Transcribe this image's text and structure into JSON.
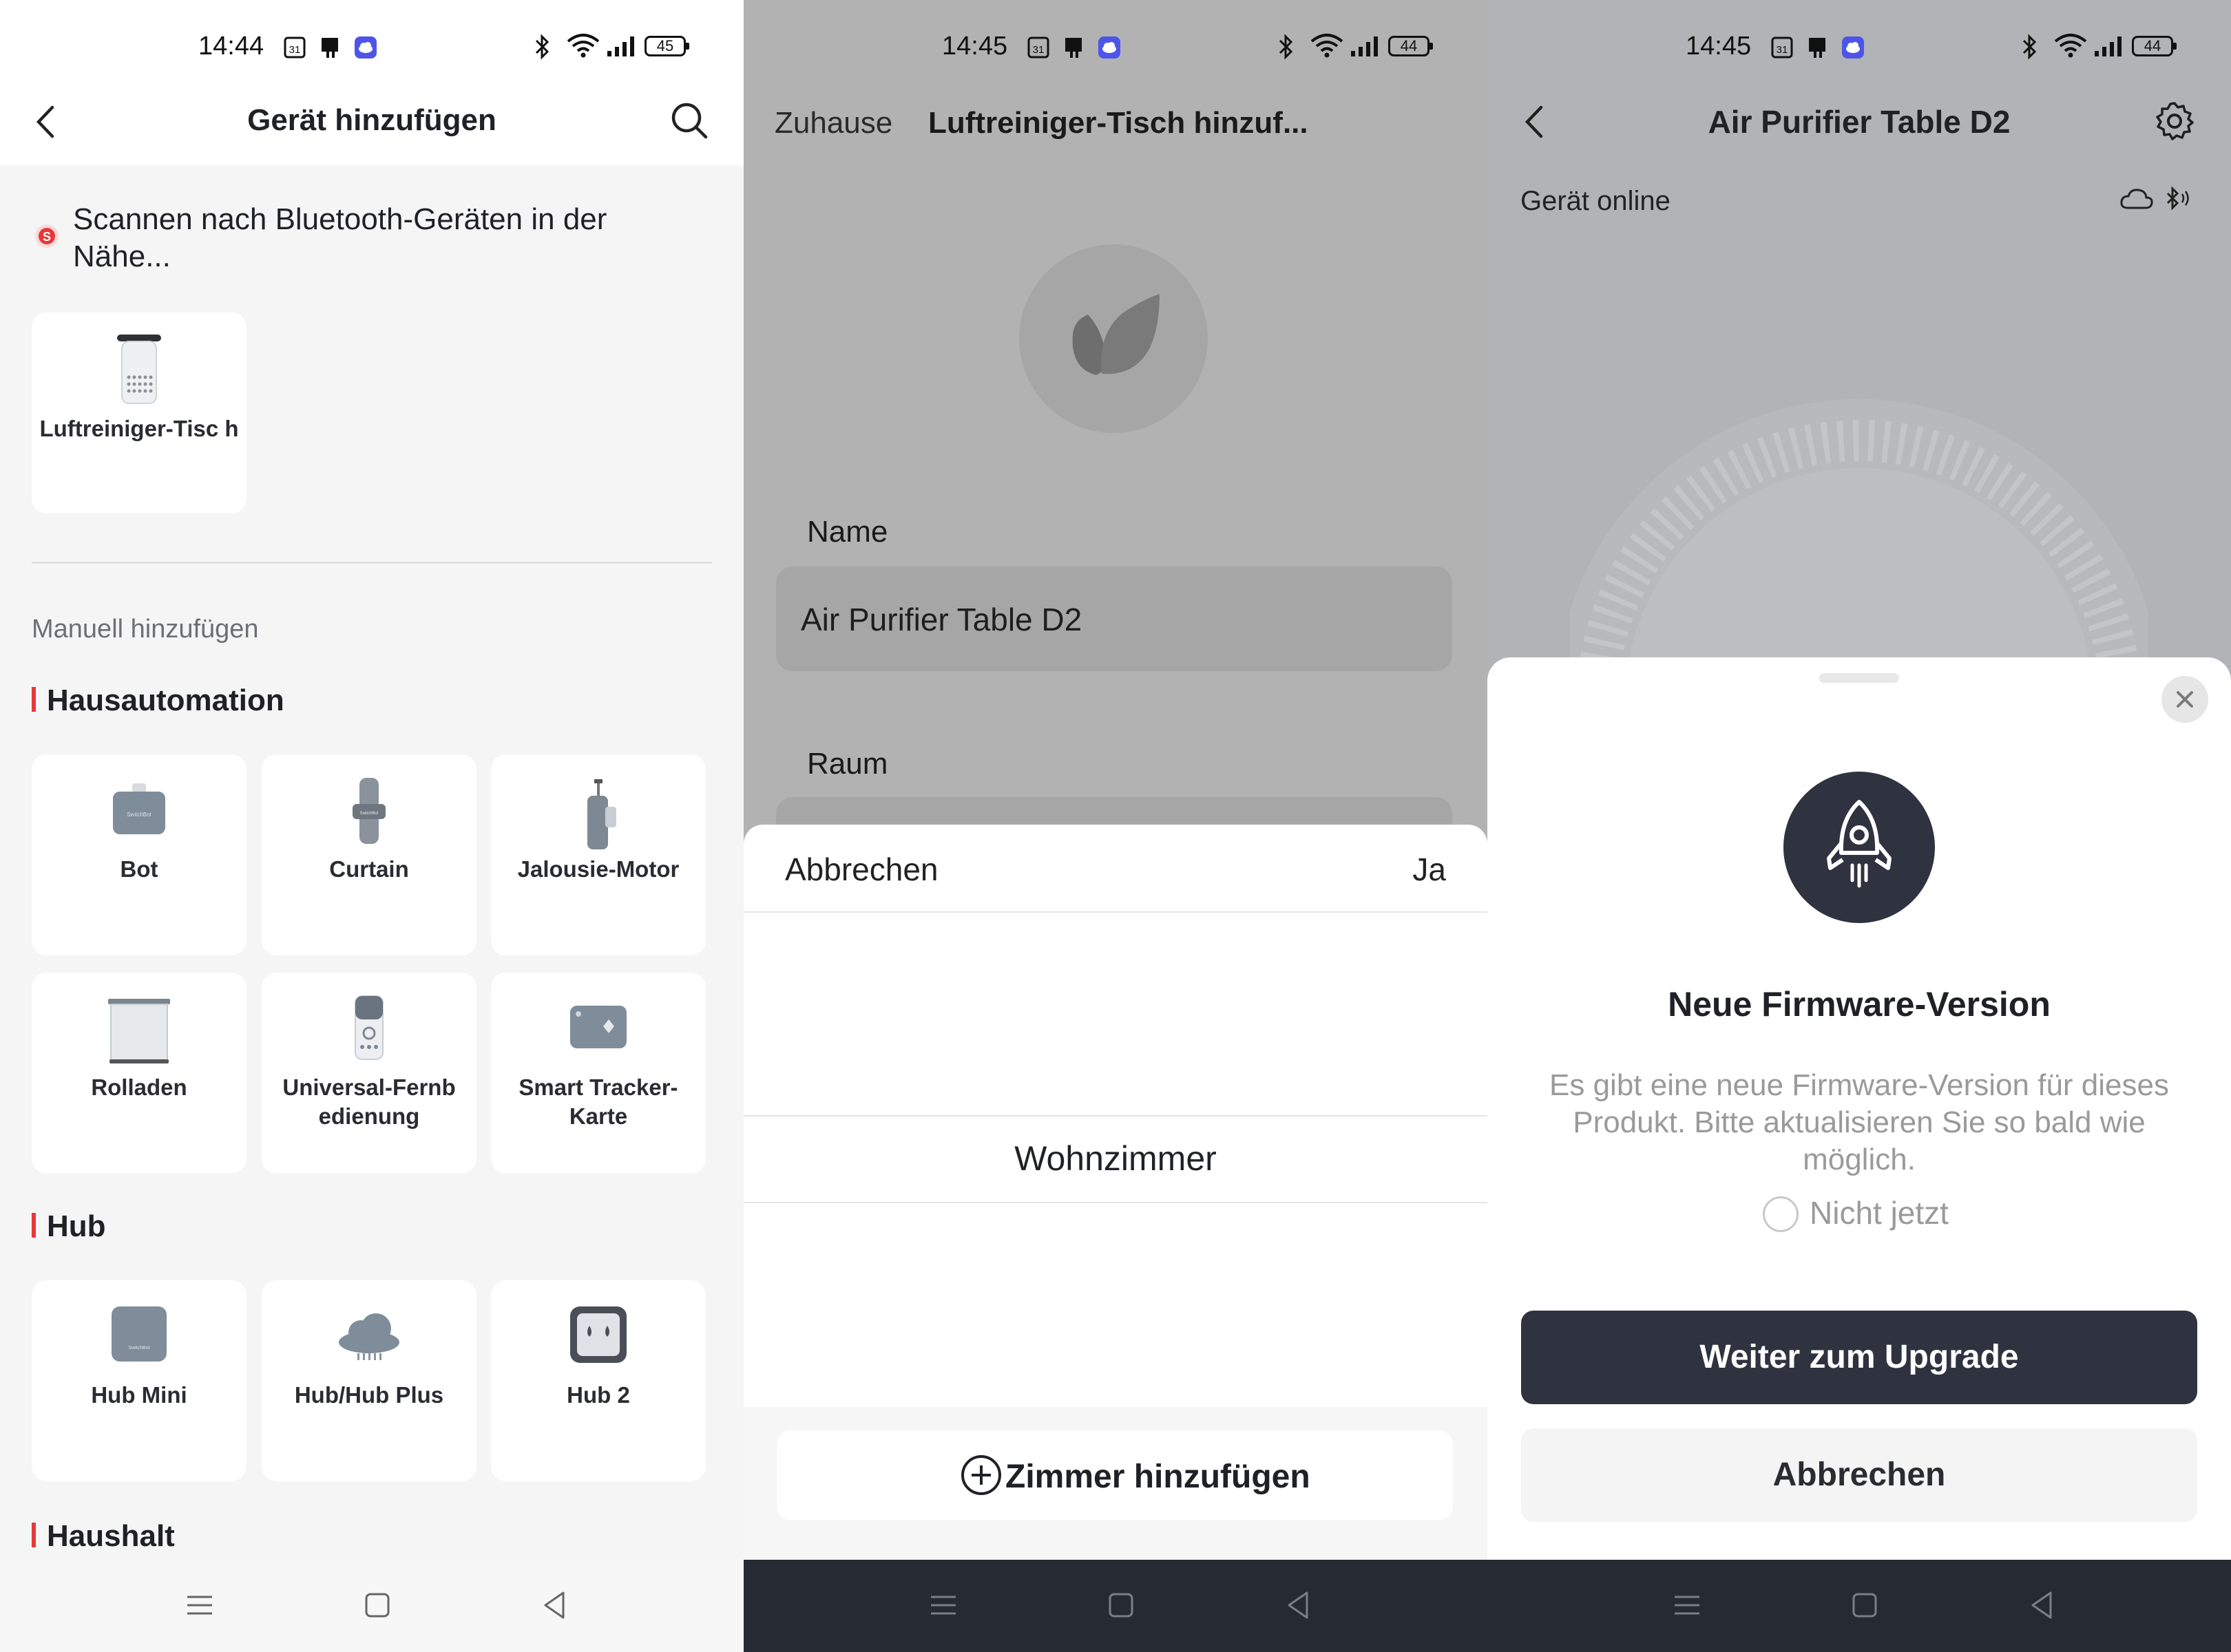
{
  "screen1": {
    "status": {
      "time": "14:44",
      "calendar_badge": "31",
      "battery": "45"
    },
    "title": "Gerät hinzufügen",
    "scanning_text": "Scannen nach Bluetooth-Geräten in der Nähe...",
    "found_device": {
      "label": "Luftreiniger-Tisc h"
    },
    "manual_label": "Manuell hinzufügen",
    "sections": [
      {
        "title": "Hausautomation",
        "items": [
          {
            "label": "Bot",
            "icon": "bot-device-icon"
          },
          {
            "label": "Curtain",
            "icon": "curtain-device-icon"
          },
          {
            "label": "Jalousie-Motor",
            "icon": "blind-motor-icon"
          },
          {
            "label": "Rolladen",
            "icon": "roller-shade-icon"
          },
          {
            "label": "Universal-Fernb edienung",
            "icon": "remote-control-icon"
          },
          {
            "label": "Smart Tracker-Karte",
            "icon": "tracker-card-icon"
          }
        ]
      },
      {
        "title": "Hub",
        "items": [
          {
            "label": "Hub Mini",
            "icon": "hub-mini-icon"
          },
          {
            "label": "Hub/Hub Plus",
            "icon": "hub-plus-icon"
          },
          {
            "label": "Hub 2",
            "icon": "hub-2-icon"
          }
        ]
      },
      {
        "title": "Haushalt",
        "items": []
      }
    ]
  },
  "screen2": {
    "status": {
      "time": "14:45",
      "calendar_badge": "31",
      "battery": "44"
    },
    "home_label": "Zuhause",
    "title": "Luftreiniger-Tisch hinzuf...",
    "name_label": "Name",
    "name_value": "Air Purifier Table D2",
    "room_label": "Raum",
    "sheet": {
      "cancel_label": "Abbrechen",
      "confirm_label": "Ja",
      "room_option": "Wohnzimmer",
      "add_room_label": "Zimmer hinzufügen"
    }
  },
  "screen3": {
    "status": {
      "time": "14:45",
      "calendar_badge": "31",
      "battery": "44"
    },
    "title": "Air Purifier Table D2",
    "online_label": "Gerät online",
    "modal": {
      "title": "Neue Firmware-Version",
      "body": "Es gibt eine neue Firmware-Version für dieses Produkt. Bitte aktualisieren Sie so bald wie möglich.",
      "checkbox_label": "Nicht jetzt",
      "primary_button": "Weiter zum Upgrade",
      "secondary_button": "Abbrechen"
    }
  },
  "colors": {
    "accent_red": "#e8383a",
    "dark_button": "#2f3340",
    "rocket_circle": "#2f3340"
  }
}
